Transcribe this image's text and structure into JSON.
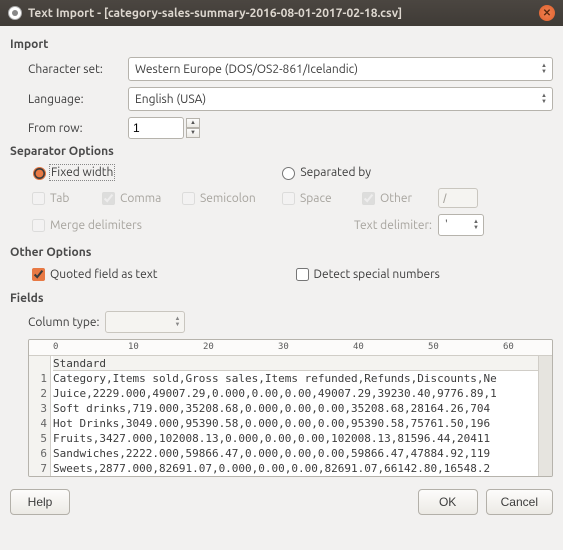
{
  "titlebar": {
    "title": "Text Import - [category-sales-summary-2016-08-01-2017-02-18.csv]"
  },
  "import": {
    "heading": "Import",
    "charset_label": "Character set:",
    "charset_value": "Western Europe (DOS/OS2-861/Icelandic)",
    "language_label": "Language:",
    "language_value": "English (USA)",
    "fromrow_label": "From row:",
    "fromrow_value": "1"
  },
  "separator": {
    "heading": "Separator Options",
    "fixed_label": "Fixed width",
    "separated_label": "Separated by",
    "selected": "fixed",
    "tab": "Tab",
    "comma": "Comma",
    "semicolon": "Semicolon",
    "space": "Space",
    "other": "Other",
    "other_value": "/",
    "merge": "Merge delimiters",
    "text_delim_label": "Text delimiter:",
    "text_delim_value": "'"
  },
  "other": {
    "heading": "Other Options",
    "quoted": "Quoted field as text",
    "detect": "Detect special numbers"
  },
  "fields": {
    "heading": "Fields",
    "coltype_label": "Column type:",
    "ruler_ticks": [
      "0",
      "10",
      "20",
      "30",
      "40",
      "50",
      "60"
    ],
    "col_header": "Standard",
    "rows": [
      "Category,Items sold,Gross sales,Items refunded,Refunds,Discounts,Ne",
      "Juice,2229.000,49007.29,0.000,0.00,0.00,49007.29,39230.40,9776.89,1",
      "Soft drinks,719.000,35208.68,0.000,0.00,0.00,35208.68,28164.26,704",
      "Hot Drinks,3049.000,95390.58,0.000,0.00,0.00,95390.58,75761.50,196",
      "Fruits,3427.000,102008.13,0.000,0.00,0.00,102008.13,81596.44,20411",
      "Sandwiches,2222.000,59866.47,0.000,0.00,0.00,59866.47,47884.92,119",
      "Sweets,2877.000,82691.07,0.000,0.00,0.00,82691.07,66142.80,16548.2"
    ]
  },
  "buttons": {
    "help": "Help",
    "ok": "OK",
    "cancel": "Cancel"
  },
  "icons": {
    "close": "✕"
  }
}
